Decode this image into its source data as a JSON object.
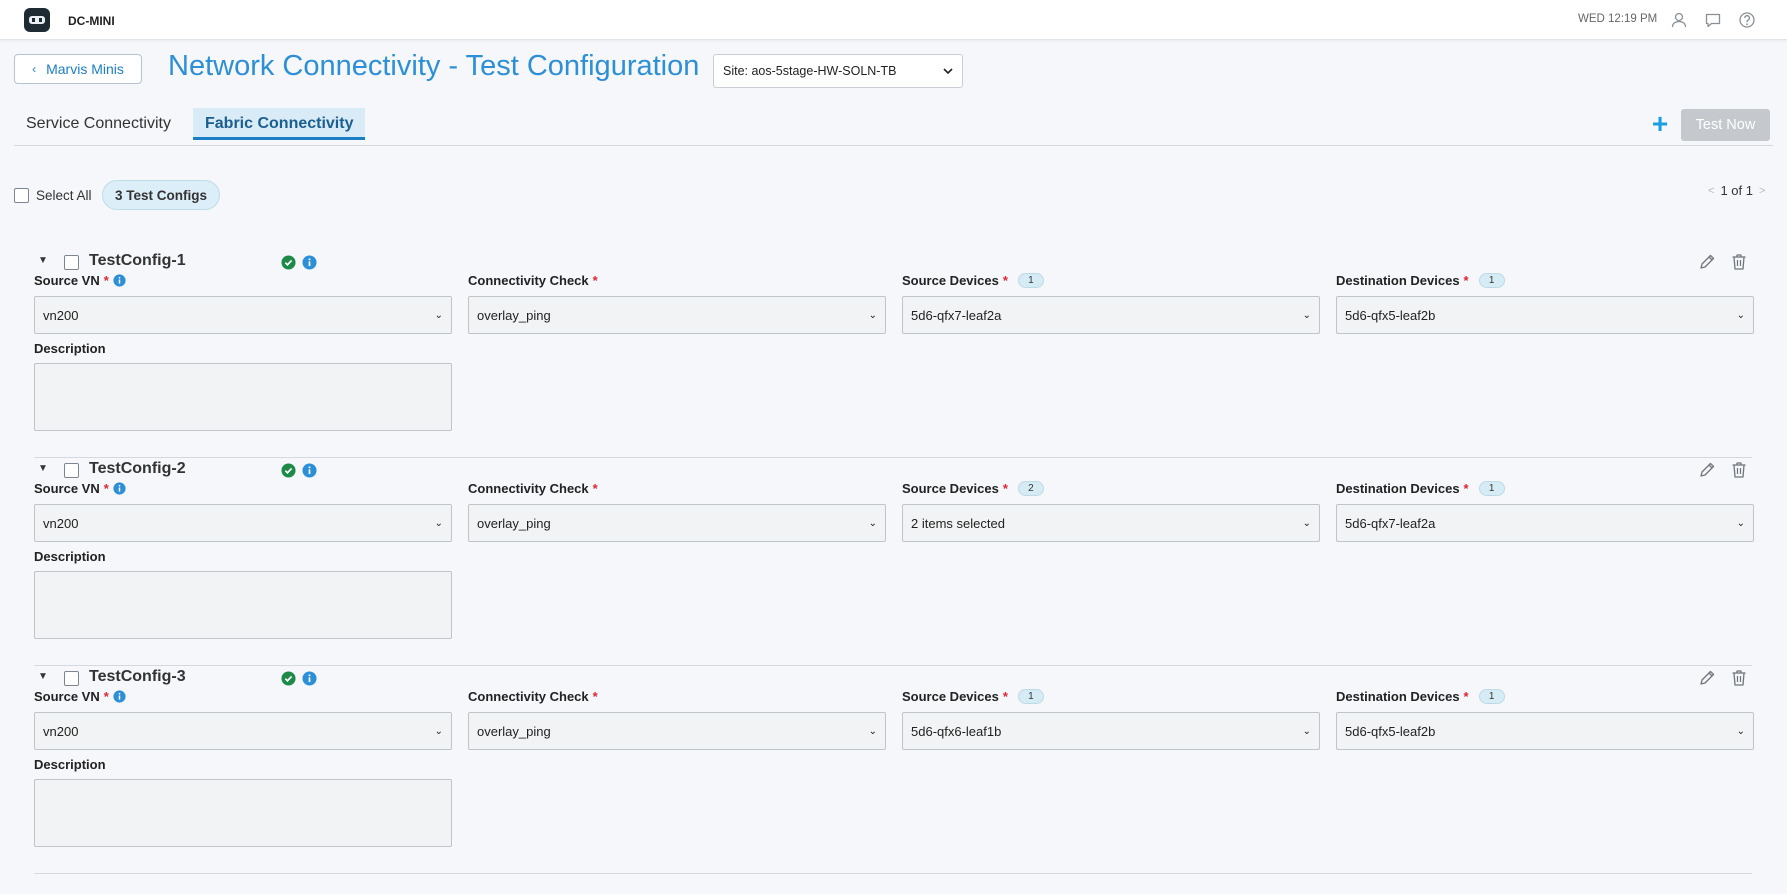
{
  "topbar": {
    "org_name": "DC-MINI",
    "clock": "WED 12:19 PM",
    "icons": [
      "user-icon",
      "chat-icon",
      "help-icon"
    ]
  },
  "header": {
    "back_label": "Marvis Minis",
    "title": "Network Connectivity - Test Configuration",
    "site_select": "Site: aos-5stage-HW-SOLN-TB"
  },
  "tabs": {
    "items": [
      {
        "label": "Service Connectivity",
        "active": false
      },
      {
        "label": "Fabric Connectivity",
        "active": true
      }
    ],
    "plus_label": "+",
    "test_now_label": "Test Now"
  },
  "list_header": {
    "select_all_label": "Select All",
    "count_label": "3 Test Configs",
    "pager_label": "1 of 1"
  },
  "field_labels": {
    "source_vn": "Source VN",
    "connectivity_check": "Connectivity Check",
    "source_devices": "Source Devices",
    "destination_devices": "Destination Devices",
    "description": "Description",
    "required_mark": "*"
  },
  "configs": [
    {
      "name": "TestConfig-1",
      "source_vn": "vn200",
      "connectivity_check": "overlay_ping",
      "source_devices_count": "1",
      "source_devices": "5d6-qfx7-leaf2a",
      "destination_devices_count": "1",
      "destination_devices": "5d6-qfx5-leaf2b",
      "description": ""
    },
    {
      "name": "TestConfig-2",
      "source_vn": "vn200",
      "connectivity_check": "overlay_ping",
      "source_devices_count": "2",
      "source_devices": "2 items selected",
      "destination_devices_count": "1",
      "destination_devices": "5d6-qfx7-leaf2a",
      "description": ""
    },
    {
      "name": "TestConfig-3",
      "source_vn": "vn200",
      "connectivity_check": "overlay_ping",
      "source_devices_count": "1",
      "source_devices": "5d6-qfx6-leaf1b",
      "destination_devices_count": "1",
      "destination_devices": "5d6-qfx5-leaf2b",
      "description": ""
    }
  ],
  "colors": {
    "accent": "#1a7fc4",
    "title": "#2d8fd5",
    "success": "#1e8a4a",
    "required": "#e0242f",
    "disabled_button": "#c5c9cd"
  }
}
